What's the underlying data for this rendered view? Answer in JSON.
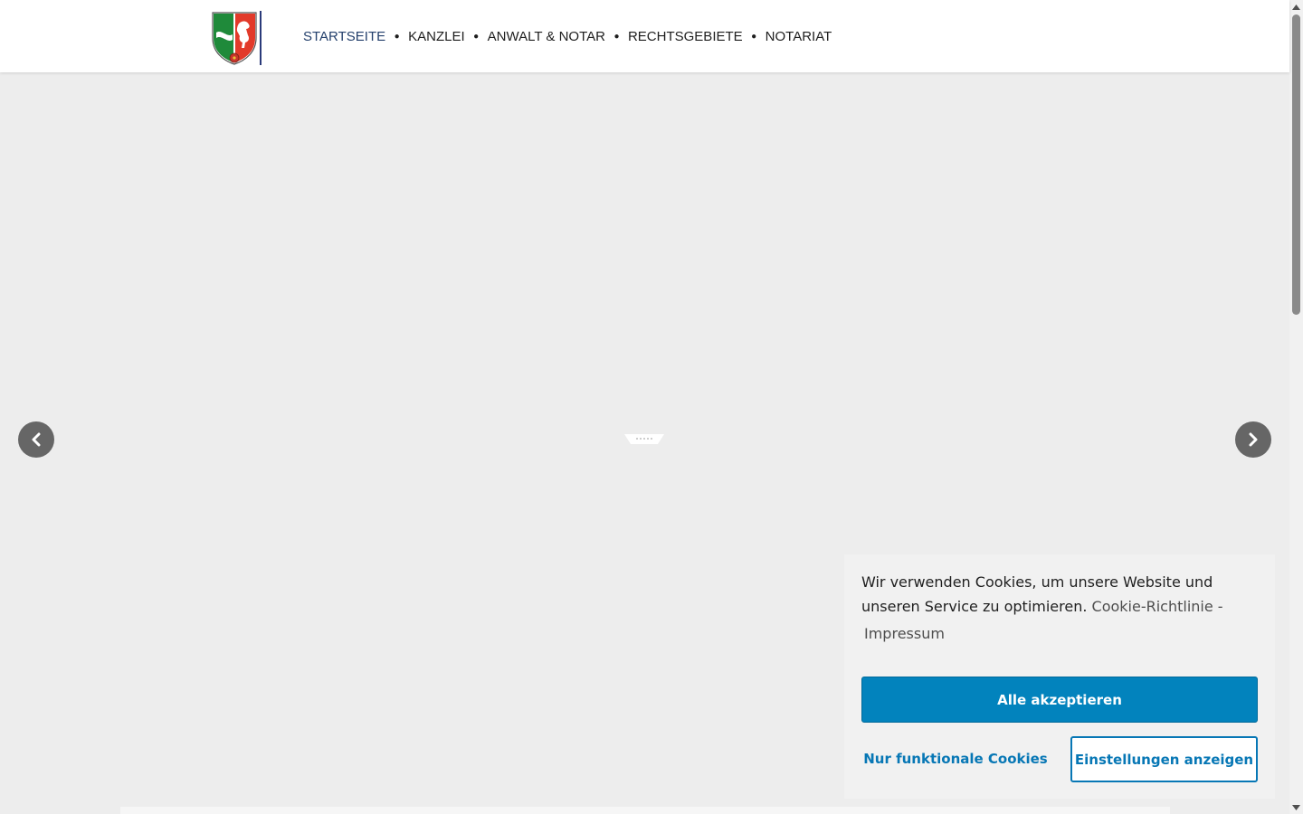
{
  "nav": {
    "items": [
      {
        "label": "STARTSEITE",
        "active": true
      },
      {
        "label": "KANZLEI",
        "active": false
      },
      {
        "label": "ANWALT & NOTAR",
        "active": false
      },
      {
        "label": "RECHTSGEBIETE",
        "active": false
      },
      {
        "label": "NOTARIAT",
        "active": false
      }
    ],
    "active_color": "#24406c"
  },
  "slider": {
    "prev_icon": "chevron-left-icon",
    "next_icon": "chevron-right-icon"
  },
  "cookie": {
    "text": "Wir verwenden Cookies, um unsere Website und unseren Service zu optimieren.",
    "policy_link": "Cookie-Richtlinie",
    "separator": "-",
    "imprint_link": "Impressum",
    "accept_all": "Alle akzeptieren",
    "functional_only": "Nur funktionale Cookies",
    "show_settings": "Einstellungen anzeigen",
    "accent_color": "#0283bd"
  }
}
